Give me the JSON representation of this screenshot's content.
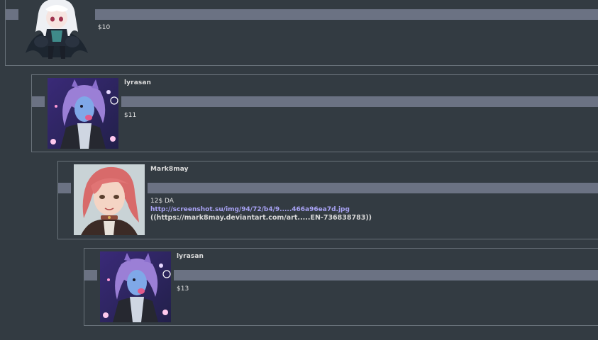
{
  "comments": [
    {
      "username": "",
      "message": "$10",
      "avatar": "white-haired-dark-outfit-chibi"
    },
    {
      "username": "lyrasan",
      "message": "$11",
      "avatar": "purple-wolf-character"
    },
    {
      "username": "Mark8may",
      "message": "12$ DA",
      "link": "http://screenshot.su/img/94/72/b4/9.....466a96ea7d.jpg",
      "extra": "((https://mark8may.deviantart.com/art.....EN-736838783))",
      "avatar": "red-haired-girl-portrait"
    },
    {
      "username": "lyrasan",
      "message": "$13",
      "avatar": "purple-wolf-character"
    }
  ],
  "colors": {
    "background": "#333b42",
    "separator_bar": "#6b7283",
    "border": "#69727a",
    "link": "#a9a3f5"
  }
}
